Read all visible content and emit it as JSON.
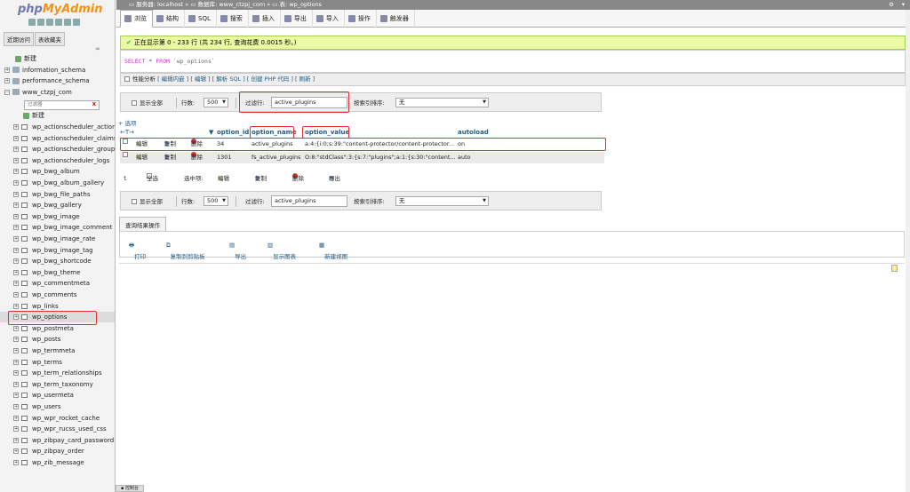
{
  "brand": {
    "php": "php",
    "my": "MyAdmin"
  },
  "sidebar": {
    "tabs": [
      "近期访问",
      "表收藏夹"
    ],
    "filter_placeholder": "过滤器",
    "filter_clear": "X",
    "new_label": "新建",
    "databases": [
      "information_schema",
      "performance_schema",
      "www_ctzpj_com"
    ],
    "tables": [
      "wp_actionscheduler_actions",
      "wp_actionscheduler_claims",
      "wp_actionscheduler_groups",
      "wp_actionscheduler_logs",
      "wp_bwg_album",
      "wp_bwg_album_gallery",
      "wp_bwg_file_paths",
      "wp_bwg_gallery",
      "wp_bwg_image",
      "wp_bwg_image_comment",
      "wp_bwg_image_rate",
      "wp_bwg_image_tag",
      "wp_bwg_shortcode",
      "wp_bwg_theme",
      "wp_commentmeta",
      "wp_comments",
      "wp_links",
      "wp_options",
      "wp_postmeta",
      "wp_posts",
      "wp_termmeta",
      "wp_terms",
      "wp_term_relationships",
      "wp_term_taxonomy",
      "wp_usermeta",
      "wp_users",
      "wp_wpr_rocket_cache",
      "wp_wpr_rucss_used_css",
      "wp_zibpay_card_password",
      "wp_zibpay_order",
      "wp_zib_message"
    ],
    "selected_table": "wp_options"
  },
  "breadcrumb": {
    "server_label": "服务器:",
    "server": "localhost",
    "db_label": "数据库:",
    "db": "www_ctzpj_com",
    "table_label": "表:",
    "table": "wp_options",
    "sep": "»"
  },
  "topnav": [
    "浏览",
    "结构",
    "SQL",
    "搜索",
    "插入",
    "导出",
    "导入",
    "操作",
    "触发器"
  ],
  "success_msg": "正在显示第 0 - 233 行 (共 234 行, 查询花费 0.0015 秒。)",
  "sql": {
    "select": "SELECT",
    "star": "*",
    "from": "FROM",
    "table": "`wp_options`"
  },
  "profiling": {
    "label": "性能分析",
    "links": [
      "[ 编辑内嵌 ]",
      "[ 编辑 ]",
      "[ 解析 SQL ]",
      "[ 创建 PHP 代码 ]",
      "[ 刷新 ]"
    ]
  },
  "nav": {
    "show_all": "显示全部",
    "rows_label": "行数:",
    "rows_value": "500",
    "filter_label": "过滤行:",
    "filter_value": "active_plugins",
    "sort_label": "按索引排序:",
    "sort_value": "无"
  },
  "options_link": "+ 选项",
  "table": {
    "arrows": "←T→",
    "columns": [
      "option_id",
      "option_name",
      "option_value",
      "autoload"
    ],
    "actions": {
      "edit": "编辑",
      "copy": "复制",
      "delete": "删除"
    },
    "rows": [
      {
        "option_id": "34",
        "option_name": "active_plugins",
        "option_value": "a:4:{i:0;s:39:\"content-protector/content-protector...",
        "autoload": "on"
      },
      {
        "option_id": "1301",
        "option_name": "fs_active_plugins",
        "option_value": "O:8:\"stdClass\":3:{s:7:\"plugins\";a:1:{s:30:\"content...",
        "autoload": "auto"
      }
    ]
  },
  "bulk": {
    "check_all": "全选",
    "selected": "选中项:",
    "edit": "编辑",
    "copy": "复制",
    "delete": "删除",
    "export": "导出"
  },
  "query_ops": {
    "title": "查询结果操作",
    "items": [
      "打印",
      "复制到剪贴板",
      "导出",
      "显示图表",
      "新建视图"
    ]
  },
  "console": "控制台"
}
